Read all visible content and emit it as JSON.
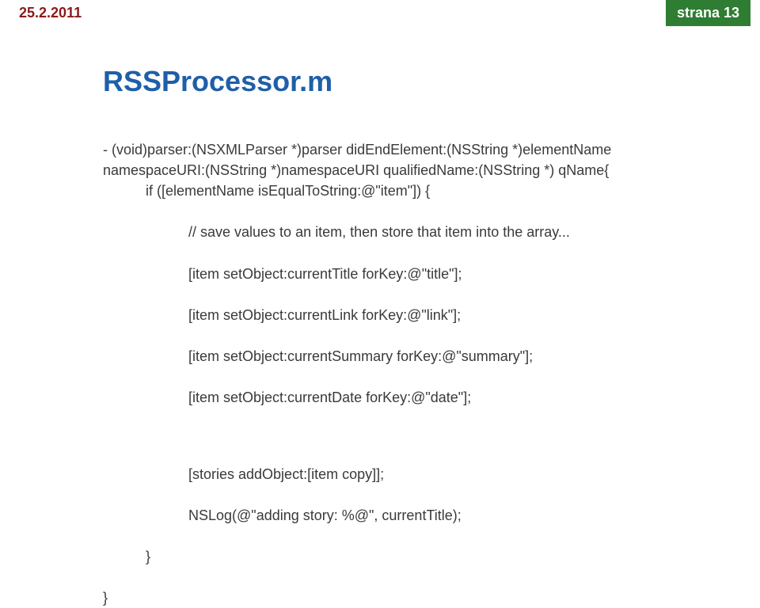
{
  "header": {
    "date": "25.2.2011",
    "page_label": "strana 13"
  },
  "title": "RSSProcessor.m",
  "code": {
    "line1": "- (void)parser:(NSXMLParser *)parser didEndElement:(NSString *)elementName namespaceURI:(NSString *)namespaceURI qualifiedName:(NSString *) qName{",
    "line2": "if ([elementName isEqualToString:@\"item\"]) {",
    "line3": "// save values to an item, then store that item into the array...",
    "line4": "[item setObject:currentTitle forKey:@\"title\"];",
    "line5": "[item setObject:currentLink forKey:@\"link\"];",
    "line6": "[item setObject:currentSummary forKey:@\"summary\"];",
    "line7": "[item setObject:currentDate forKey:@\"date\"];",
    "line8": "[stories addObject:[item copy]];",
    "line9": "NSLog(@\"adding story: %@\", currentTitle);",
    "line10": "}",
    "line11": "}"
  }
}
